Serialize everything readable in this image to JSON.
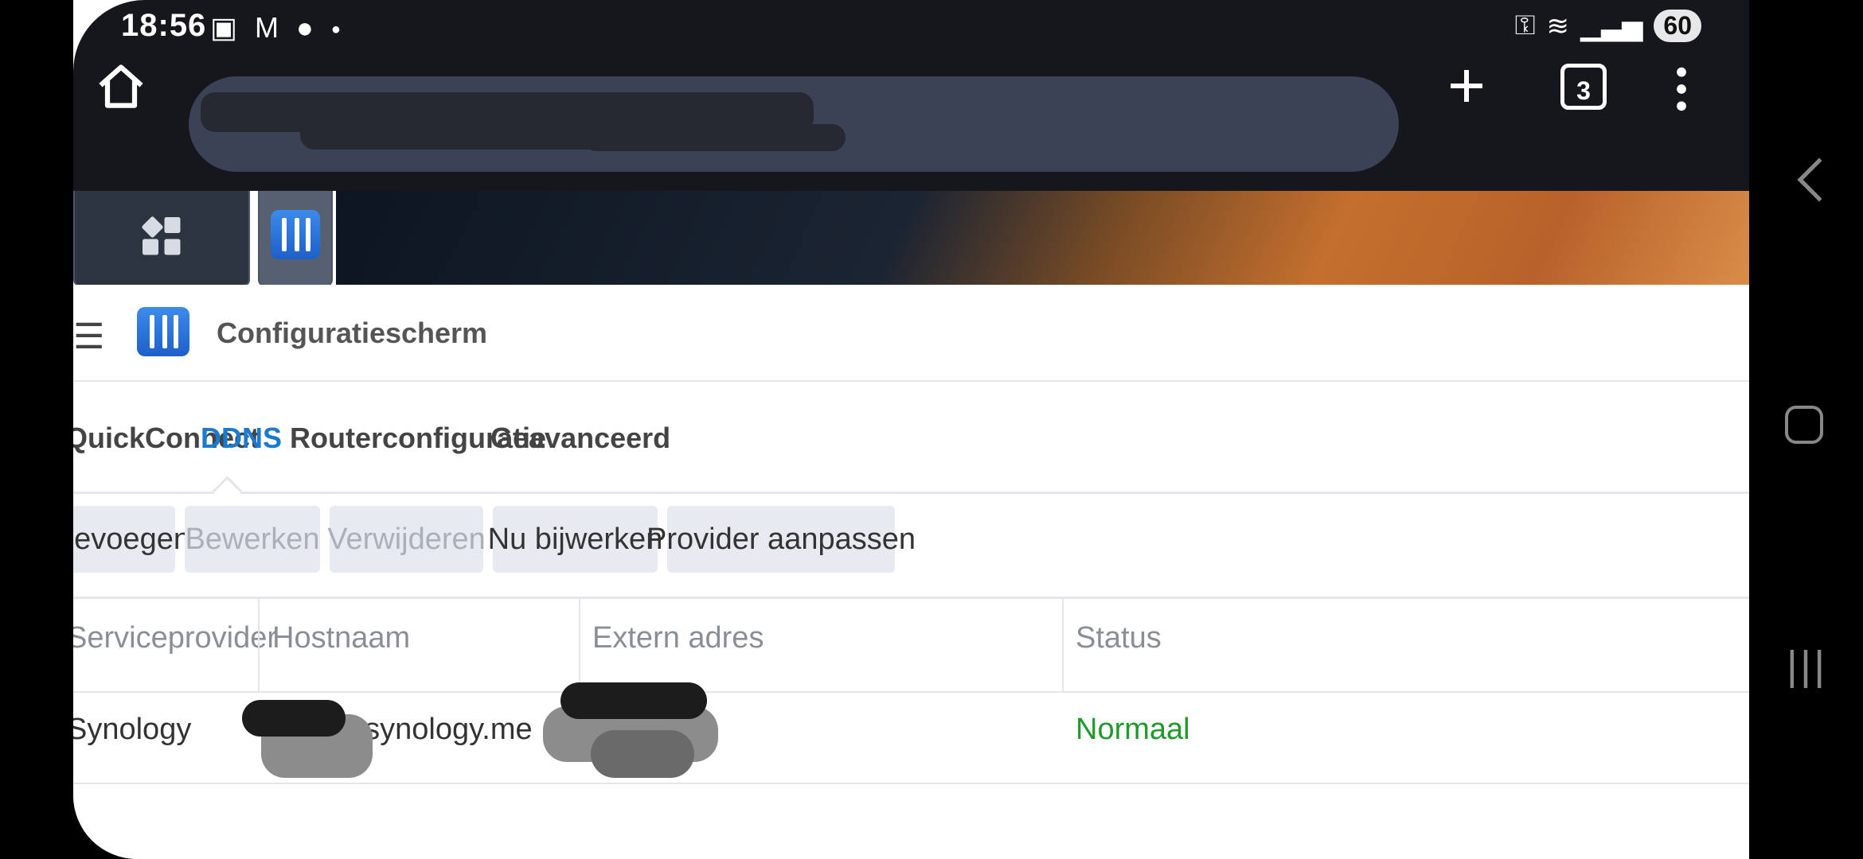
{
  "status_bar": {
    "time": "18:56",
    "battery": "60",
    "left_icons": [
      "screenshot-icon",
      "gmail-icon",
      "chat-icon",
      "dot-icon"
    ],
    "right_icons": [
      "vpn-key-icon",
      "wifi-icon",
      "signal-icon"
    ]
  },
  "browser": {
    "tab_count": "3"
  },
  "window": {
    "title": "Configuratiescherm"
  },
  "tabs": [
    {
      "label": "QuickConnect",
      "active": false
    },
    {
      "label": "DDNS",
      "active": true
    },
    {
      "label": "Routerconfiguratie",
      "active": false
    },
    {
      "label": "Geavanceerd",
      "active": false
    }
  ],
  "toolbar": {
    "add": "Toevoegen",
    "edit": "Bewerken",
    "delete": "Verwijderen",
    "update_now": "Nu bijwerken",
    "customize_provider": "Provider aanpassen"
  },
  "table": {
    "headers": {
      "provider": "Serviceprovider",
      "hostname": "Hostnaam",
      "external_address": "Extern adres",
      "status": "Status"
    },
    "rows": [
      {
        "provider": "Synology",
        "hostname": "t.synology.me",
        "external_address": "",
        "status": "Normaal"
      }
    ]
  },
  "colors": {
    "accent": "#1a7ad0",
    "status_ok": "#1f9a2b"
  }
}
